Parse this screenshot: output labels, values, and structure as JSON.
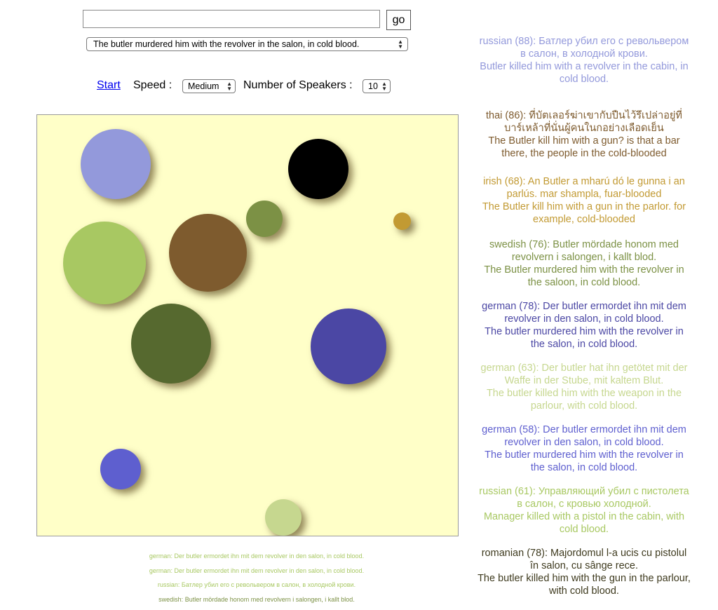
{
  "controls": {
    "search_value": "",
    "go_label": "go",
    "sentence_selected": "The butler murdered him with the revolver in the salon, in cold blood.",
    "start_label": "Start",
    "speed_label": "Speed :",
    "speed_selected": "Medium",
    "speakers_label": "Number of Speakers :",
    "speakers_selected": "10"
  },
  "stage": {
    "background": "#ffffc8",
    "balls": [
      {
        "name": "ball-periwinkle",
        "color": "#9399db"
      },
      {
        "name": "ball-black",
        "color": "#000000"
      },
      {
        "name": "ball-olive-small",
        "color": "#7c9145"
      },
      {
        "name": "ball-mustard",
        "color": "#c29a33"
      },
      {
        "name": "ball-lime",
        "color": "#a8c862"
      },
      {
        "name": "ball-brown",
        "color": "#7e5b2e"
      },
      {
        "name": "ball-dark-green",
        "color": "#56692f"
      },
      {
        "name": "ball-indigo",
        "color": "#4b47a4"
      },
      {
        "name": "ball-blue",
        "color": "#5e5fcf"
      },
      {
        "name": "ball-pale-green",
        "color": "#c6d78f"
      }
    ]
  },
  "log": [
    {
      "text": "german: Der butler ermordet ihn mit dem revolver in den salon, in cold blood.",
      "color": "#a8c862"
    },
    {
      "text": "german: Der butler ermordet ihn mit dem revolver in den salon, in cold blood.",
      "color": "#a8c862"
    },
    {
      "text": "russian: Батлер убил его с револьвером в салон, в холодной крови.",
      "color": "#a8c862"
    },
    {
      "text": "swedish: Butler mördade honom med revolvern i salongen, i kallt blod.",
      "color": "#7c9145"
    }
  ],
  "speeches": [
    {
      "lang": "russian",
      "score": 88,
      "original": "Батлер убил его с револьвером в салон, в холодной крови.",
      "translation": "Butler killed him with a revolver in the cabin, in cold blood.",
      "color": "#9399db"
    },
    {
      "lang": "thai",
      "score": 86,
      "original": "ที่บัตเลอร์ฆ่าเขากับปืนไว้รึเปล่าอยู่ที่บาร์เหล้าที่นั่นผู้คนในกอย่างเลือดเย็น",
      "translation": "The Butler kill him with a gun? is that a bar there, the people in the cold-blooded",
      "color": "#7e5b2e"
    },
    {
      "lang": "irish",
      "score": 68,
      "original": "An Butler a mharú dó le gunna i an parlús. mar shampla, fuar-blooded",
      "translation": "The Butler kill him with a gun in the parlor. for example, cold-blooded",
      "color": "#c29a33"
    },
    {
      "lang": "swedish",
      "score": 76,
      "original": "Butler mördade honom med revolvern i salongen, i kallt blod.",
      "translation": "The Butler murdered him with the revolver in the saloon, in cold blood.",
      "color": "#7c9145"
    },
    {
      "lang": "german",
      "score": 78,
      "original": "Der butler ermordet ihn mit dem revolver in den salon, in cold blood.",
      "translation": "The butler murdered him with the revolver in the salon, in cold blood.",
      "color": "#4b47a4"
    },
    {
      "lang": "german",
      "score": 63,
      "original": "Der butler hat ihn getötet mit der Waffe in der Stube, mit kaltem Blut.",
      "translation": "The butler killed him with the weapon in the parlour, with cold blood.",
      "color": "#c6d78f"
    },
    {
      "lang": "german",
      "score": 58,
      "original": "Der butler ermordet ihn mit dem revolver in den salon, in cold blood.",
      "translation": "The butler murdered him with the revolver in the salon, in cold blood.",
      "color": "#5e5fcf"
    },
    {
      "lang": "russian",
      "score": 61,
      "original": "Управляющий убил с пистолета в салон, с кровью холодной.",
      "translation": "Manager killed with a pistol in the cabin, with cold blood.",
      "color": "#a8c862"
    },
    {
      "lang": "romanian",
      "score": 78,
      "original": "Majordomul l-a ucis cu pistolul în salon, cu sânge rece.",
      "translation": "The butler killed him with the gun in the parlour, with cold blood.",
      "color": "#3e3a1e"
    }
  ]
}
